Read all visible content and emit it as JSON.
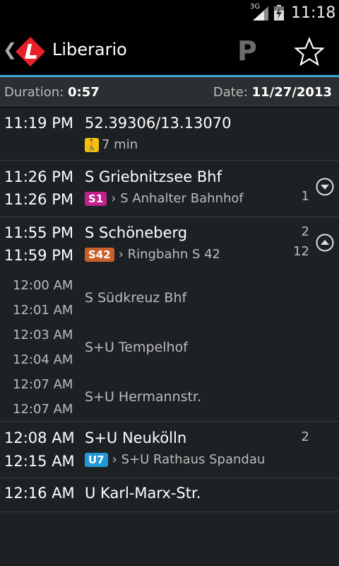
{
  "status": {
    "network": "3G",
    "time": "11:18"
  },
  "app": {
    "title": "Liberario"
  },
  "actions": {
    "parking": "P"
  },
  "summary": {
    "duration_label": "Duration:",
    "duration": "0:57",
    "date_label": "Date:",
    "date": "11/27/2013"
  },
  "legs": [
    {
      "time1": "11:19 PM",
      "stop": "52.39306/13.13070",
      "walk": "7 min"
    },
    {
      "time1": "11:26 PM",
      "stop": "S Griebnitzsee Bhf",
      "time2": "11:26 PM",
      "line": "S1",
      "line_color": "#c3208b",
      "direction": "S Anhalter Bahnhof",
      "platform1": "1"
    },
    {
      "time1": "11:55 PM",
      "stop": "S Schöneberg",
      "time2": "11:59 PM",
      "line": "S42",
      "line_color": "#c9602a",
      "direction": "Ringbahn S 42",
      "platform1": "2",
      "platform2": "12",
      "intermediate": [
        {
          "arr": "12:00 AM",
          "dep": "12:01 AM",
          "stop": "S Südkreuz Bhf"
        },
        {
          "arr": "12:03 AM",
          "dep": "12:04 AM",
          "stop": "S+U Tempelhof"
        },
        {
          "arr": "12:07 AM",
          "dep": "12:07 AM",
          "stop": "S+U Hermannstr."
        }
      ]
    },
    {
      "time1": "12:08 AM",
      "stop": "S+U Neukölln",
      "time2": "12:15 AM",
      "line": "U7",
      "line_color": "#1f9ad6",
      "direction": "S+U Rathaus Spandau",
      "platform1": "2"
    },
    {
      "time1": "12:16 AM",
      "stop": "U Karl-Marx-Str."
    }
  ]
}
